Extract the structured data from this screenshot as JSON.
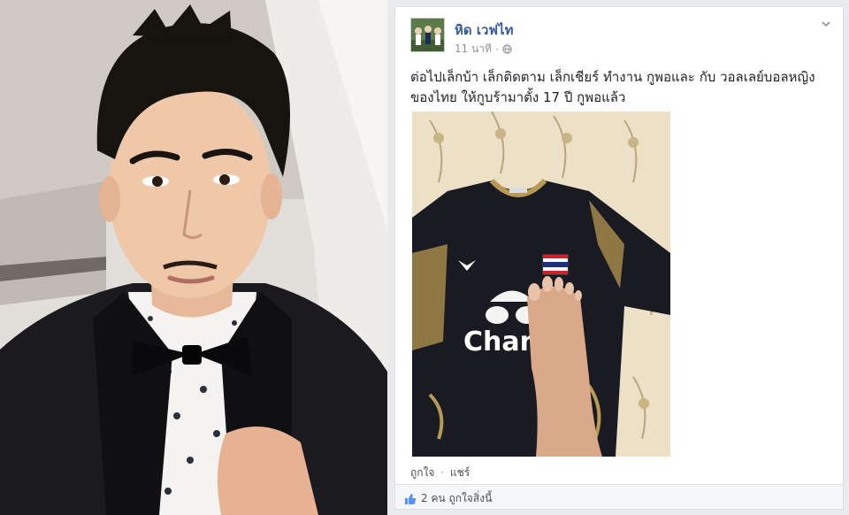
{
  "post": {
    "author": "หิด เวฟไท",
    "time": "11 นาที",
    "text_line1": "ต่อไปเล็กบ้า เล็กติดตาม เล็กเชียร์ ทำงาน กูพอและ กับ วอลเลย์บอลหญิง",
    "text_line2": "ของไทย ให้กูบร้ามาตั้ง 17 ปี กูพอแล้ว",
    "photo_brand_text": "Chan",
    "actions": {
      "like": "ถูกใจ",
      "separator": "·",
      "share": "แชร์"
    },
    "likes_summary": "2 คน ถูกใจสิ่งนี้"
  },
  "icons": {
    "globe": "globe-icon",
    "chevron": "chevron-down-icon",
    "thumb": "thumbs-up-icon",
    "flag": "thai-flag-icon"
  },
  "colors": {
    "link_blue": "#365899",
    "text_dark": "#1d2129",
    "meta_gray": "#90949c",
    "jersey_black": "#1a1a22",
    "jersey_gold": "#b89a55"
  }
}
